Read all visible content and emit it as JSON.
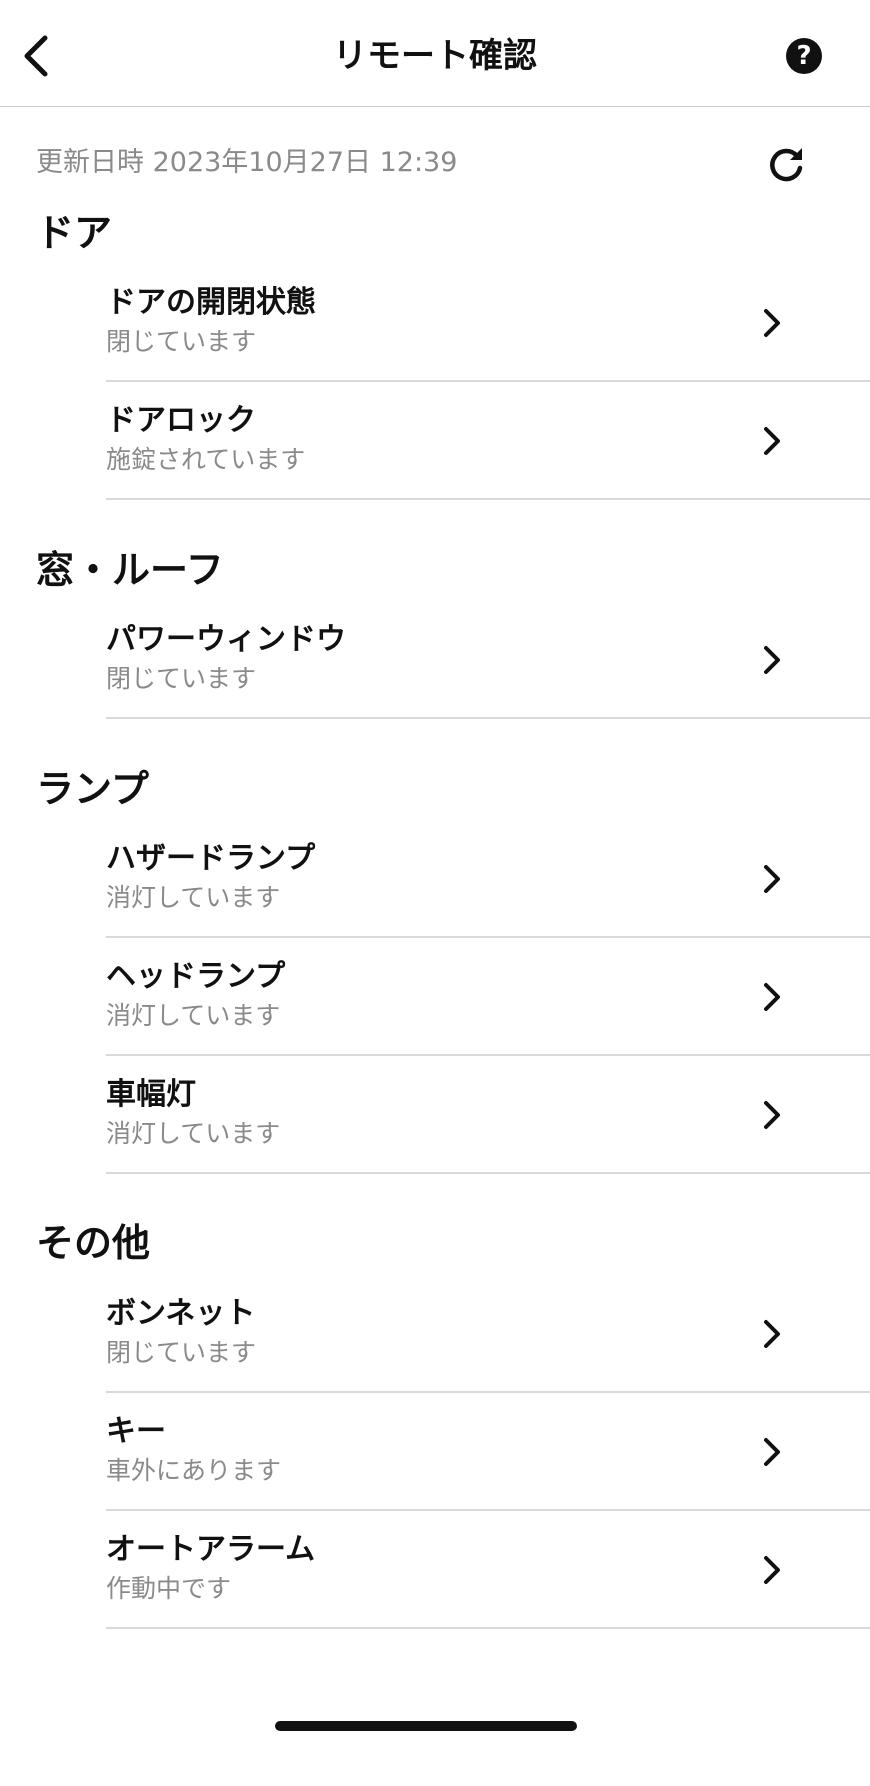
{
  "header": {
    "title": "リモート確認",
    "help_glyph": "?"
  },
  "updated": {
    "text": "更新日時 2023年10月27日 12:39"
  },
  "sections": [
    {
      "title": "ドア",
      "items": [
        {
          "label": "ドアの開閉状態",
          "status": "閉じています"
        },
        {
          "label": "ドアロック",
          "status": "施錠されています"
        }
      ]
    },
    {
      "title": "窓・ルーフ",
      "items": [
        {
          "label": "パワーウィンドウ",
          "status": "閉じています"
        }
      ]
    },
    {
      "title": "ランプ",
      "items": [
        {
          "label": "ハザードランプ",
          "status": "消灯しています"
        },
        {
          "label": "ヘッドランプ",
          "status": "消灯しています"
        },
        {
          "label": "車幅灯",
          "status": "消灯しています"
        }
      ]
    },
    {
      "title": "その他",
      "items": [
        {
          "label": "ボンネット",
          "status": "閉じています"
        },
        {
          "label": "キー",
          "status": "車外にあります"
        },
        {
          "label": "オートアラーム",
          "status": "作動中です"
        }
      ]
    }
  ],
  "icons": {
    "back": "chevron-left-icon",
    "help": "question-circle-icon",
    "refresh": "refresh-icon",
    "row_arrow": "chevron-right-icon"
  }
}
